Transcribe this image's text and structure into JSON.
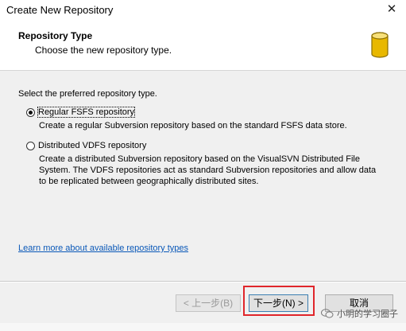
{
  "window": {
    "title": "Create New Repository",
    "close_glyph": "✕"
  },
  "header": {
    "title": "Repository Type",
    "subtitle": "Choose the new repository type.",
    "icon": "database-icon",
    "icon_color": "#e8b800"
  },
  "content": {
    "prompt": "Select the preferred repository type.",
    "options": [
      {
        "label": "Regular FSFS repository",
        "selected": true,
        "description": "Create a regular Subversion repository based on the standard FSFS data store."
      },
      {
        "label": "Distributed VDFS repository",
        "selected": false,
        "description": "Create a distributed Subversion repository based on the VisualSVN Distributed File System. The VDFS repositories act as standard Subversion repositories and allow data to be replicated between geographically distributed sites."
      }
    ],
    "learn_more_link": "Learn more about available repository types"
  },
  "footer": {
    "prev_label": "< 上一步(B)",
    "next_label": "下一步(N) >",
    "cancel_label": "取消",
    "highlight_color": "#e0262b"
  },
  "watermark": {
    "text": "小明的学习圈子",
    "icon": "wechat-icon"
  }
}
